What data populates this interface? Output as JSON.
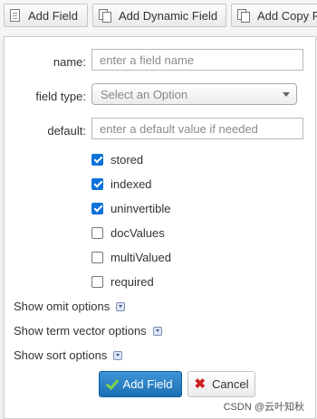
{
  "toolbar": {
    "add_field": "Add Field",
    "add_dynamic_field": "Add Dynamic Field",
    "add_copy_field": "Add Copy F"
  },
  "form": {
    "name": {
      "label": "name:",
      "placeholder": "enter a field name"
    },
    "field_type": {
      "label": "field type:",
      "placeholder": "Select an Option"
    },
    "default": {
      "label": "default:",
      "placeholder": "enter a default value if needed"
    },
    "checkboxes": [
      {
        "label": "stored",
        "checked": true
      },
      {
        "label": "indexed",
        "checked": true
      },
      {
        "label": "uninvertible",
        "checked": true
      },
      {
        "label": "docValues",
        "checked": false
      },
      {
        "label": "multiValued",
        "checked": false
      },
      {
        "label": "required",
        "checked": false
      }
    ],
    "show_options": [
      "Show omit options",
      "Show term vector options",
      "Show sort options"
    ],
    "submit_label": "Add Field",
    "cancel_label": "Cancel"
  },
  "watermark": "CSDN @云叶知秋",
  "colors": {
    "accent": "#1b6fb5",
    "checkbox": "#0b72d8",
    "cancel_icon": "#d02020",
    "check_icon": "#7cd34b"
  }
}
